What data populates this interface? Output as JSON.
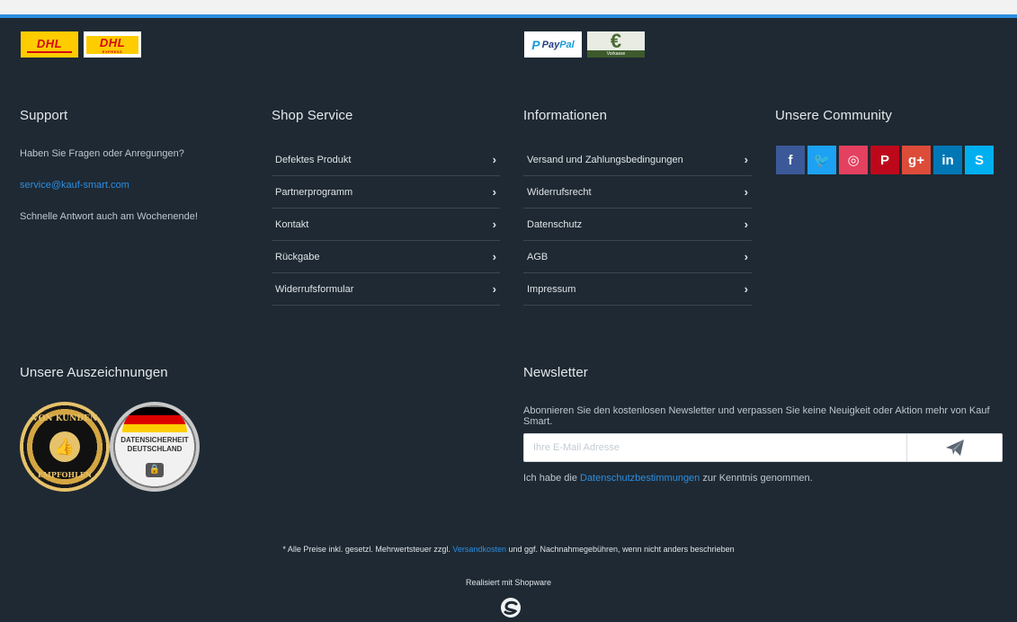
{
  "logos": {
    "dhl": "DHL",
    "dhl_express": "DHL",
    "dhl_express_tag": "EXPRESS",
    "paypal_a": "Pay",
    "paypal_b": "Pal",
    "vorkasse_symbol": "€",
    "vorkasse": "Vorkasse"
  },
  "support": {
    "title": "Support",
    "line1": "Haben Sie Fragen oder Anregungen?",
    "email": "service@kauf-smart.com",
    "line2": "Schnelle Antwort auch am Wochenende!"
  },
  "shop_service": {
    "title": "Shop Service",
    "items": [
      "Defektes Produkt",
      "Partnerprogramm",
      "Kontakt",
      "Rückgabe",
      "Widerrufsformular"
    ]
  },
  "informationen": {
    "title": "Informationen",
    "items": [
      "Versand und Zahlungsbedingungen",
      "Widerrufsrecht",
      "Datenschutz",
      "AGB",
      "Impressum"
    ]
  },
  "community": {
    "title": "Unsere Community",
    "icons": [
      {
        "name": "facebook-icon",
        "glyph": "f",
        "color": "#3b5998"
      },
      {
        "name": "twitter-icon",
        "glyph": "🐦",
        "color": "#1da1f2"
      },
      {
        "name": "instagram-icon",
        "glyph": "◎",
        "color": "#e4405f"
      },
      {
        "name": "pinterest-icon",
        "glyph": "P",
        "color": "#bd081c"
      },
      {
        "name": "google-plus-icon",
        "glyph": "g+",
        "color": "#dd4b39"
      },
      {
        "name": "linkedin-icon",
        "glyph": "in",
        "color": "#0077b5"
      },
      {
        "name": "skype-icon",
        "glyph": "S",
        "color": "#00aff0"
      }
    ]
  },
  "awards": {
    "title": "Unsere Auszeichnungen",
    "badge1_top": "VON KUNDEN",
    "badge1_bottom": "EMPFOHLEN",
    "badge2_line1": "DATENSICHERHEIT",
    "badge2_line2": "DEUTSCHLAND"
  },
  "newsletter": {
    "title": "Newsletter",
    "text": "Abonnieren Sie den kostenlosen Newsletter und verpassen Sie keine Neuigkeit oder Aktion mehr von Kauf Smart.",
    "placeholder": "Ihre E-Mail Adresse",
    "consent_a": "Ich habe die ",
    "consent_link": "Datenschutzbestimmungen",
    "consent_b": " zur Kenntnis genommen."
  },
  "footer": {
    "vat_a": "* Alle Preise inkl. gesetzl. Mehrwertsteuer zzgl. ",
    "vat_link": "Versandkosten",
    "vat_b": " und ggf. Nachnahmegebühren, wenn nicht anders beschrieben",
    "realized": "Realisiert mit Shopware"
  }
}
